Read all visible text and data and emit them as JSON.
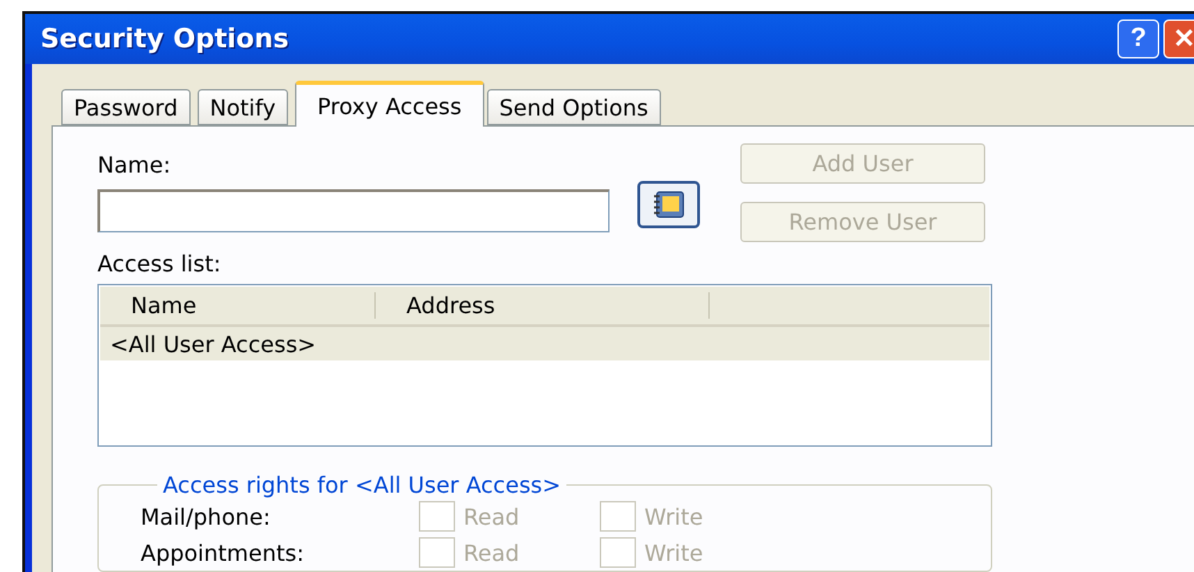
{
  "window": {
    "title": "Security Options",
    "controls": [
      {
        "kind": "help",
        "label": "?"
      },
      {
        "kind": "close",
        "label": "✕"
      }
    ]
  },
  "tabs": [
    {
      "label": "Password",
      "selected": false
    },
    {
      "label": "Notify",
      "selected": false
    },
    {
      "label": "Proxy Access",
      "selected": true
    },
    {
      "label": "Send Options",
      "selected": false
    }
  ],
  "name_field": {
    "label": "Name:"
  },
  "buttons": [
    {
      "label": "Add User",
      "disabled": true
    },
    {
      "label": "Remove User",
      "disabled": true
    }
  ],
  "access_list": {
    "label": "Access list:",
    "columns": [
      "Name",
      "Address"
    ],
    "rows": [
      {
        "name": "<All User Access>",
        "selected": true
      }
    ]
  },
  "access_rights": {
    "title": "Access rights for <All User Access>",
    "rows": [
      {
        "label": "Mail/phone:",
        "options": [
          {
            "label": "Read",
            "checked": false,
            "disabled": true
          },
          {
            "label": "Write",
            "checked": false,
            "disabled": true
          }
        ]
      },
      {
        "label": "Appointments:",
        "options": [
          {
            "label": "Read",
            "checked": false,
            "disabled": true
          },
          {
            "label": "Write",
            "checked": false,
            "disabled": true
          }
        ]
      }
    ]
  }
}
